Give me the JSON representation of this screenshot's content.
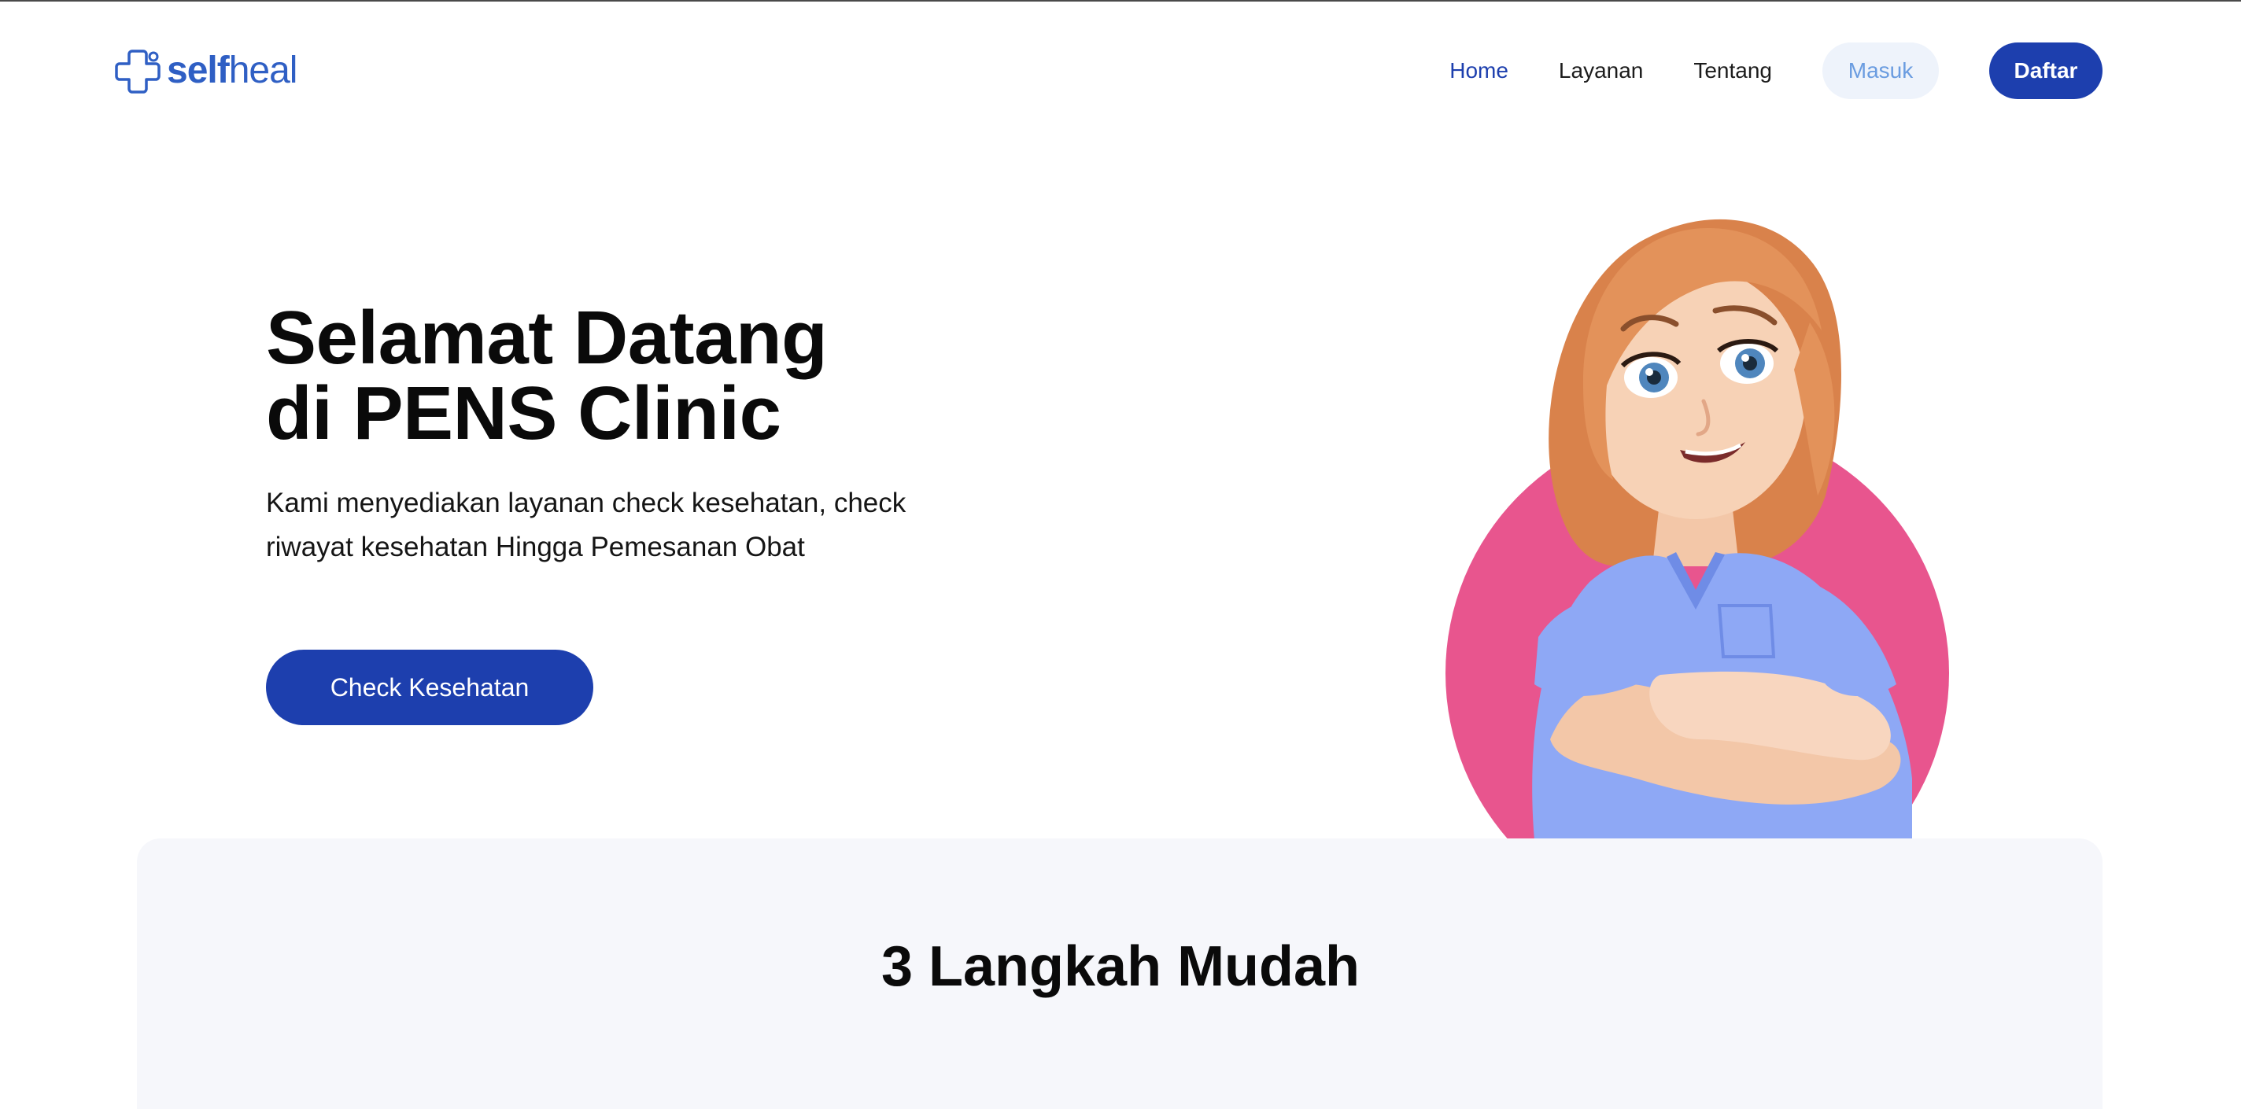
{
  "brand": {
    "name_bold": "self",
    "name_light": "heal",
    "color": "#2f5fc4"
  },
  "nav": {
    "links": [
      "Home",
      "Layanan",
      "Tentang"
    ],
    "active": "Home",
    "login_label": "Masuk",
    "register_label": "Daftar"
  },
  "hero": {
    "title_line1": "Selamat Datang",
    "title_line2": "di PENS Clinic",
    "subtitle_line1": "Kami menyediakan layanan check kesehatan, check",
    "subtitle_line2": "riwayat kesehatan Hingga Pemesanan Obat",
    "cta_label": "Check Kesehatan",
    "illustration": "doctor-woman-avatar"
  },
  "steps": {
    "title": "3 Langkah Mudah"
  },
  "colors": {
    "primary": "#1d3fae",
    "accent_pink": "#e8558e",
    "panel_bg": "#f6f7fb",
    "login_bg": "#eef3fb",
    "login_text": "#6a9ce0"
  }
}
